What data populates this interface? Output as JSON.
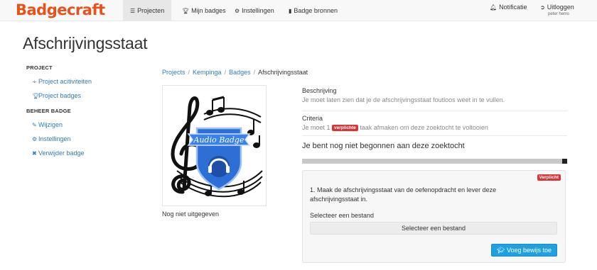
{
  "brand": {
    "logo_part1": "Badge",
    "logo_part2": "craft"
  },
  "nav": {
    "items": [
      {
        "label": "Projecten",
        "icon": "list-icon",
        "active": true
      },
      {
        "label": "Mijn badges",
        "icon": "trophy-icon",
        "active": false
      },
      {
        "label": "Instellingen",
        "icon": "cogs-icon",
        "active": false
      },
      {
        "label": "Badge bronnen",
        "icon": "book-icon",
        "active": false
      }
    ],
    "notification_label": "Notificatie",
    "logout_label": "Uitloggen",
    "username": "peter hems"
  },
  "page": {
    "title": "Afschrijvingsstaat"
  },
  "sidebar": {
    "project_heading": "PROJECT",
    "project_links": [
      {
        "label": "Project acitiviteiten",
        "icon": "rss-icon"
      },
      {
        "label": "Project badges",
        "icon": "trophy-icon"
      }
    ],
    "manage_heading": "BEHEER BADGE",
    "manage_links": [
      {
        "label": "Wijzigen",
        "icon": "edit-icon"
      },
      {
        "label": "Instellingen",
        "icon": "gear-icon"
      },
      {
        "label": "Verwijder badge",
        "icon": "times-icon"
      }
    ]
  },
  "breadcrumb": {
    "items": [
      "Projects",
      "Kempinga",
      "Badges"
    ],
    "current": "Afschrijvingsstaat"
  },
  "badge": {
    "image_text": "Audio Badge",
    "status": "Nog niet uitgegeven"
  },
  "details": {
    "description_label": "Beschrijving",
    "description": "Je moet laten zien dat je de afschrijvingsstaat foutloos weet in te vullen.",
    "criteria_label": "Criteria",
    "criteria_prefix": "Je moet 1",
    "criteria_pill": "verplichte",
    "criteria_suffix": "taak afmaken om deze zoektocht te voltooien",
    "not_started": "Je bent nog niet begonnen aan deze zoektocht",
    "progress_fraction": 0
  },
  "task": {
    "badge": "Verplicht",
    "text": "1. Maak de afschrijvingsstaat van de oefenopdracht en lever deze afschrijvingsstaat in.",
    "file_label": "Selecteer een bestand",
    "file_button": "Selecteer een bestand",
    "submit_button": "Voeg bewijs toe"
  },
  "colors": {
    "brand_orange": "#e8521a",
    "link_blue": "#337ab7",
    "required_red": "#d9343a",
    "submit_blue": "#1fa0e0",
    "badge_blue": "#2e6fd6"
  }
}
